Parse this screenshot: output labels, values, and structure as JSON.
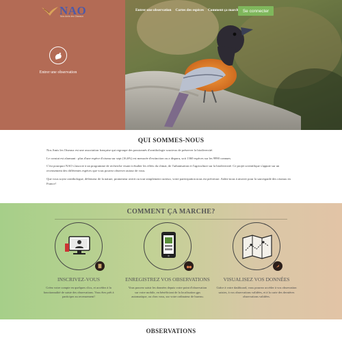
{
  "header": {
    "logo_text": "NAO",
    "logo_subtitle": "Nos Amis les Oiseaux",
    "enter_observation_label": "Entrer une observation",
    "nav": [
      {
        "label": "Entrer une observation"
      },
      {
        "label": "Cartes des espèces"
      },
      {
        "label": "Comment ça marche?"
      }
    ],
    "connect_label": "Se connecter"
  },
  "who": {
    "title": "QUI SOMMES-NOUS",
    "paragraphs": [
      "Nos Amis les Oiseaux est une association française qui regroupe des passionnés d'ornithologie soucieux de préserver la biodiversité.",
      "Le constat est alarmant : plus d'une espèce d'oiseau sur sept (16,6%) est menacée d'extinction ou a disparu, soit 1360 espèces sur les 9990 connues.",
      "C'est pourquoi NAO s'associe à un programme de recherche visant à étudier les effets du climat, de l'urbanisation et l'agriculture sur la biodiversité. Ce projet scientifique s'appuie sur un recensement des différentes espèces que vous pouvez observer autour de vous.",
      "Que vous soyez ornithologue, défenseur de la nature, promeneur averti ou tout simplement curieux, votre participation nous est précieuse. Aidez-nous à œuvrer pour la sauvegarde des oiseaux en France!"
    ]
  },
  "how": {
    "title": "COMMENT ÇA MARCHE?",
    "steps": [
      {
        "title": "INSCRIVEZ-VOUS",
        "text": "Créez votre compte en quelques clics, et accédez à la fonctionnalité de saisie des observations. Vous êtes prêt à participer au recensement!"
      },
      {
        "title": "ENREGISTREZ VOS OBSERVATIONS",
        "text": "Vous pouvez saisir les données depuis votre point d'observation sur votre mobile, en bénéficiant de la localisation gps automatique, ou chez vous, sur votre ordinateur de bureau."
      },
      {
        "title": "VISUALISEZ VOS DONNÉES",
        "text": "Grâce à votre dashboard, vous pourrez accéder à vos observation saisies, à vos observations validées, et à la carte des dernières observations validées."
      }
    ]
  },
  "observations": {
    "title": "OBSERVATIONS"
  },
  "colors": {
    "hero_left": "#b36b55",
    "connect_button": "#7fb75c",
    "logo": "#4e5aa8"
  }
}
